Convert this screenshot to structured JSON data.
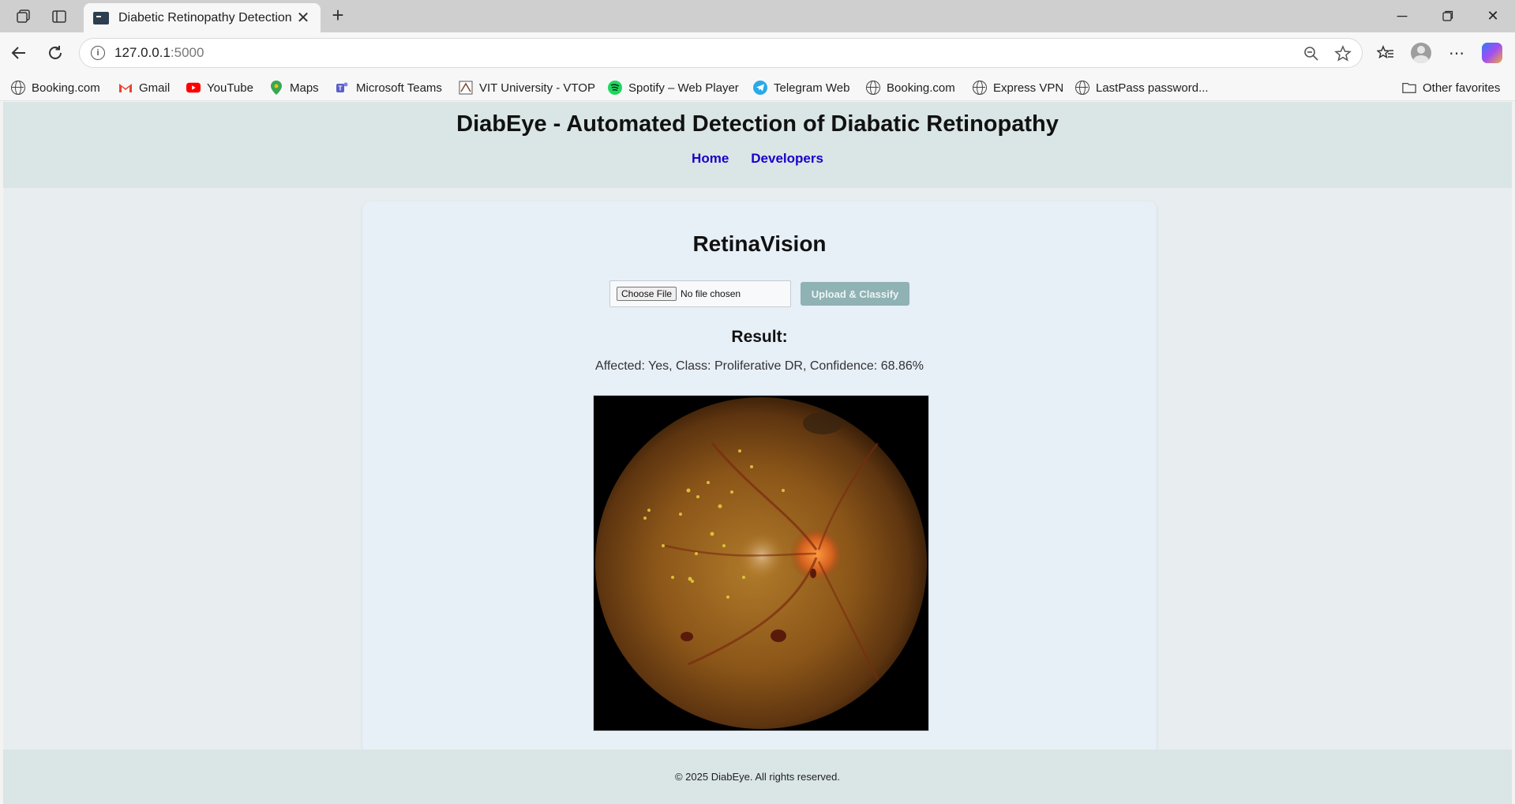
{
  "browser": {
    "tab_title": "Diabetic Retinopathy Detection",
    "url_host": "127.0.0.1",
    "url_port": ":5000",
    "bookmarks": [
      {
        "label": "Booking.com",
        "icon": "globe-icon"
      },
      {
        "label": "Gmail",
        "icon": "gmail-icon",
        "color": "#ea4335"
      },
      {
        "label": "YouTube",
        "icon": "youtube-icon",
        "color": "#ff0000"
      },
      {
        "label": "Maps",
        "icon": "maps-pin-icon",
        "color": "#34a853"
      },
      {
        "label": "Microsoft Teams",
        "icon": "teams-icon",
        "color": "#5b5fc7"
      },
      {
        "label": "VIT University - VTOP",
        "icon": "vtop-icon"
      },
      {
        "label": "Spotify – Web Player",
        "icon": "spotify-icon",
        "color": "#1ed760"
      },
      {
        "label": "Telegram Web",
        "icon": "telegram-icon",
        "color": "#29a9eb"
      },
      {
        "label": "Booking.com",
        "icon": "globe-icon"
      },
      {
        "label": "Express VPN",
        "icon": "globe-icon"
      },
      {
        "label": "LastPass password...",
        "icon": "globe-icon"
      }
    ],
    "other_favorites": "Other favorites"
  },
  "site": {
    "title": "DiabEye - Automated Detection of Diabatic Retinopathy",
    "nav": {
      "home": "Home",
      "developers": "Developers"
    },
    "link_color": "#1a00c8"
  },
  "card": {
    "title": "RetinaVision",
    "file_button": "Choose File",
    "file_status": "No file chosen",
    "upload_button": "Upload & Classify",
    "result_heading": "Result:",
    "result_text": "Affected: Yes, Class: Proliferative DR, Confidence: 68.86%"
  },
  "footer": {
    "text": "© 2025 DiabEye. All rights reserved."
  }
}
